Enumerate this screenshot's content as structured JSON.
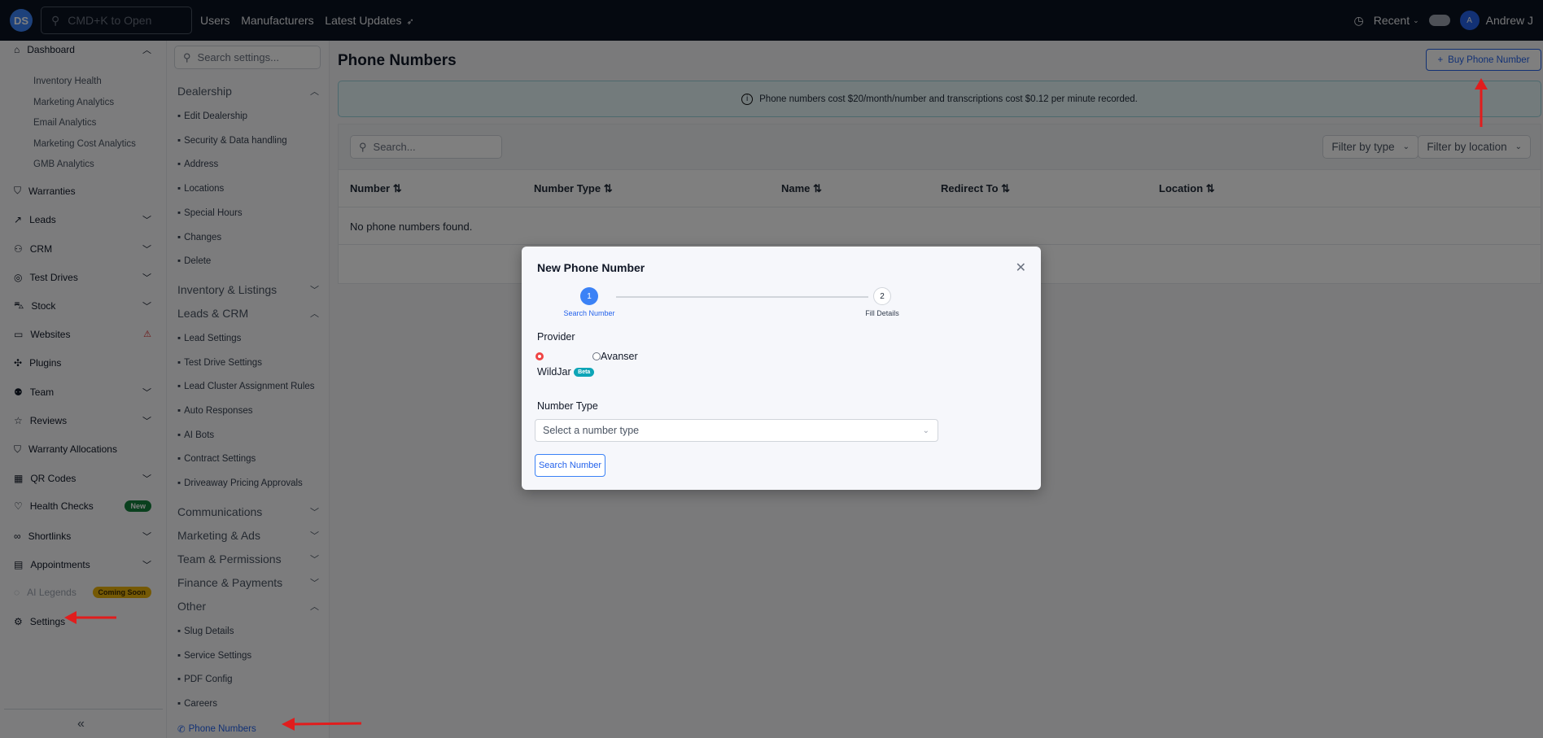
{
  "topbar": {
    "logo": "DS",
    "search_placeholder": "CMD+K to Open",
    "nav": [
      "Users",
      "Manufacturers",
      "Latest Updates"
    ],
    "recent": "Recent",
    "avatar": "A",
    "user": "Andrew J"
  },
  "sidebar": {
    "dashboard": "Dashboard",
    "sub": [
      "Inventory Health",
      "Marketing Analytics",
      "Email Analytics",
      "Marketing Cost Analytics",
      "GMB Analytics"
    ],
    "items": [
      {
        "label": "Warranties",
        "icon": "shield-icon"
      },
      {
        "label": "Leads",
        "icon": "trend-icon",
        "chev": true
      },
      {
        "label": "CRM",
        "icon": "users-icon",
        "chev": true
      },
      {
        "label": "Test Drives",
        "icon": "wheel-icon",
        "chev": true
      },
      {
        "label": "Stock",
        "icon": "car-icon",
        "chev": true
      },
      {
        "label": "Websites",
        "icon": "monitor-icon",
        "warn": true
      },
      {
        "label": "Plugins",
        "icon": "puzzle-icon"
      },
      {
        "label": "Team",
        "icon": "team-icon",
        "chev": true
      },
      {
        "label": "Reviews",
        "icon": "star-icon",
        "chev": true
      },
      {
        "label": "Warranty Allocations",
        "icon": "shield-icon"
      },
      {
        "label": "QR Codes",
        "icon": "qr-icon",
        "chev": true
      },
      {
        "label": "Health Checks",
        "icon": "heart-icon",
        "badge": "New"
      },
      {
        "label": "Shortlinks",
        "icon": "link-icon",
        "chev": true
      },
      {
        "label": "Appointments",
        "icon": "calendar-icon",
        "chev": true
      },
      {
        "label": "AI Legends",
        "icon": "ai-icon",
        "badge": "Coming Soon",
        "muted": true
      },
      {
        "label": "Settings",
        "icon": "gear-icon"
      }
    ],
    "collapse": "«"
  },
  "settings": {
    "search_placeholder": "Search settings...",
    "sections": [
      {
        "t": "Dealership",
        "open": true,
        "items": [
          "Edit Dealership",
          "Security & Data handling",
          "Address",
          "Locations",
          "Special Hours",
          "Changes",
          "Delete"
        ]
      },
      {
        "t": "Inventory & Listings"
      },
      {
        "t": "Leads & CRM",
        "open": true,
        "items": [
          "Lead Settings",
          "Test Drive Settings",
          "Lead Cluster Assignment Rules",
          "Auto Responses",
          "AI Bots",
          "Contract Settings",
          "Driveaway Pricing Approvals"
        ]
      },
      {
        "t": "Communications"
      },
      {
        "t": "Marketing & Ads"
      },
      {
        "t": "Team & Permissions"
      },
      {
        "t": "Finance & Payments"
      },
      {
        "t": "Other",
        "open": true,
        "items": [
          "Slug Details",
          "Service Settings",
          "PDF Config",
          "Careers",
          "Phone Numbers"
        ]
      }
    ]
  },
  "main": {
    "title": "Phone Numbers",
    "buy": "Buy Phone Number",
    "info": "Phone numbers cost $20/month/number and transcriptions cost $0.12 per minute recorded.",
    "search_placeholder": "Search...",
    "filter_type": "Filter by type",
    "filter_location": "Filter by location",
    "columns": [
      "Number",
      "Number Type",
      "Name",
      "Redirect To",
      "Location"
    ],
    "empty": "No phone numbers found."
  },
  "modal": {
    "title": "New Phone Number",
    "steps": [
      {
        "n": "1",
        "label": "Search Number"
      },
      {
        "n": "2",
        "label": "Fill Details"
      }
    ],
    "provider_label": "Provider",
    "providers": [
      "WildJar",
      "Avanser"
    ],
    "beta": "Beta",
    "number_type_label": "Number Type",
    "select_placeholder": "Select a number type",
    "search_button": "Search Number"
  },
  "colors": {
    "accent": "#2563eb",
    "new": "#15803d",
    "soon": "#eab308",
    "beta": "#0ea5b7"
  }
}
